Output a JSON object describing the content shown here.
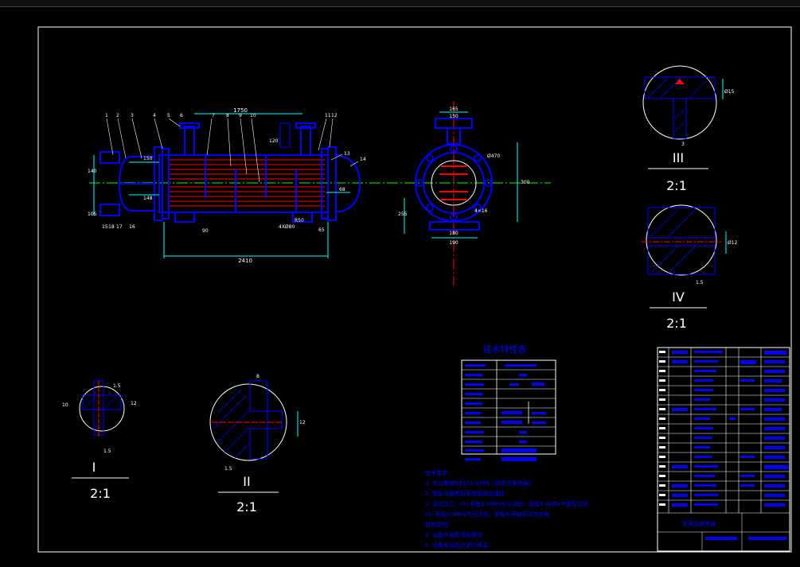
{
  "drawing": {
    "background": "#000000",
    "frame_color": "#ffffff",
    "part_color": "#0000ff",
    "hatch_color": "#0000ff",
    "tube_color": "#ff0000",
    "center_line_color": "#00ff00",
    "dim_color": "#00ffff"
  },
  "main_view": {
    "dim_top": "1750",
    "dim_bottom": "2410",
    "dim_left_1": "150",
    "dim_left_2": "148",
    "dim_left_3": "140",
    "dim_left_4": "105",
    "dim_small": "90",
    "dim_120": "120",
    "dim_68": "68",
    "dim_r50": "R50",
    "dim_4x80": "4XØ80",
    "dim_65": "65",
    "part_numbers": [
      "1",
      "2",
      "3",
      "4",
      "5",
      "6",
      "7",
      "8",
      "9",
      "10",
      "11",
      "12",
      "13",
      "14",
      "15",
      "16",
      "17",
      "18"
    ]
  },
  "side_view": {
    "dim_165": "165",
    "dim_150": "150",
    "dim_d470": "Ø470",
    "dim_300": "300",
    "dim_4x16": "4×16",
    "dim_180": "180",
    "dim_190": "190",
    "dim_255": "255"
  },
  "details": {
    "III": {
      "label": "III",
      "scale": "2:1",
      "dim": "Ø15",
      "dim2": "3"
    },
    "IV": {
      "label": "IV",
      "scale": "2:1",
      "dim": "Ø12",
      "dim2": "1.5"
    },
    "I": {
      "label": "I",
      "scale": "2:1",
      "dim1": "1.5",
      "dim2": "10",
      "dim3": "12",
      "dim4": "1.5"
    },
    "II": {
      "label": "II",
      "scale": "2:1",
      "dim1": "8",
      "dim2": "12",
      "dim3": "1.5"
    }
  },
  "spec_table": {
    "title": "技术特性表",
    "rows": 10
  },
  "notes": {
    "heading": "技术要求",
    "lines": [
      "1. 本设备按GB151-1999《管壳式换热器》",
      "2. 管板与换热管采用胀接加强焊",
      "3. 试验压力：(1) 壳程1.8MPa水压试验，管程1.8MPa气密性试验",
      "          (2) 壳程1.5MPa气压试验，管程与壳程间试验合格",
      "其他说明：",
      "4. 设备外表面涂防锈漆",
      "5. 设备安装后应进行保温"
    ]
  },
  "title_block": {
    "name": "管壳式换热器",
    "rows": 17
  }
}
